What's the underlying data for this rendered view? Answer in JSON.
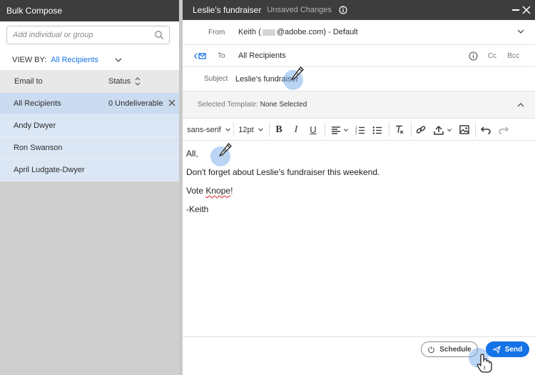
{
  "left": {
    "title": "Bulk Compose",
    "search_placeholder": "Add individual or group",
    "view_by_label": "VIEW BY:",
    "view_by_value": "All Recipients",
    "columns": [
      "Email to",
      "Status"
    ],
    "rows": [
      {
        "name": "All Recipients",
        "status": "0 Undeliverable"
      },
      {
        "name": "Andy Dwyer",
        "status": ""
      },
      {
        "name": "Ron Swanson",
        "status": ""
      },
      {
        "name": "April Ludgate-Dwyer",
        "status": ""
      }
    ]
  },
  "compose": {
    "title": "Leslie's fundraiser",
    "subtitle": "Unsaved Changes",
    "from_label": "From",
    "from_name": "Keith (",
    "from_rest": "@adobe.com) - Default",
    "to_label": "To",
    "to_value": "All Recipients",
    "cc_label": "Cc",
    "bcc_label": "Bcc",
    "subject_label": "Subject",
    "subject_value": "Leslie's fundraiser",
    "template_label": "Selected Template:",
    "template_value": "None Selected",
    "font_family": "sans-serif",
    "font_size": "12pt",
    "body": {
      "line1": "All,",
      "line2": "Don't forget about Leslie's fundraiser this weekend.",
      "line3_a": "Vote ",
      "line3_b": "Knope",
      "line3_c": "!",
      "line4": "-Keith"
    },
    "schedule_label": "Schedule",
    "send_label": "Send"
  },
  "markers": {
    "m1": "1",
    "m2": "2",
    "m3": "3"
  },
  "colors": {
    "accent": "#1473e6",
    "titlebar": "#3d3d3d",
    "selected_row": "#ccdcf0"
  }
}
